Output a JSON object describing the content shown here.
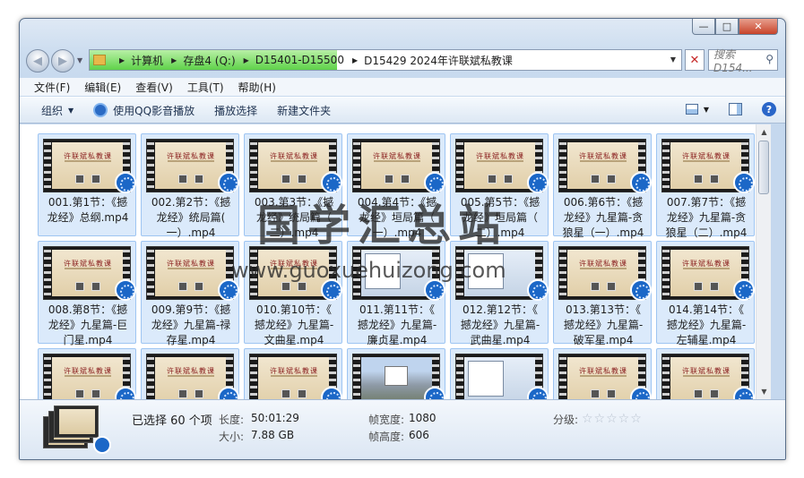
{
  "caption": {
    "min": "—",
    "max": "□",
    "close": "✕"
  },
  "address": {
    "crumbs": [
      "计算机",
      "存盘4 (Q:)",
      "D15401-D15500",
      "D15429 2024年许联斌私教课"
    ]
  },
  "search": {
    "placeholder": "搜索 D154..."
  },
  "menu": [
    "文件(F)",
    "编辑(E)",
    "查看(V)",
    "工具(T)",
    "帮助(H)"
  ],
  "commands": {
    "organize": "组织",
    "play_qq": "使用QQ影音播放",
    "play_selection": "播放选择",
    "new_folder": "新建文件夹"
  },
  "thumb_title": "许联斌私教课",
  "files": [
    {
      "name": "001.第1节：《撼龙经》总纲.mp4",
      "line1": "001.第1节：《撼",
      "line2": "龙经》总纲.mp4",
      "line3": "",
      "style": "title"
    },
    {
      "name": "002.第2节：《撼龙经》统局篇(一).mp4",
      "line1": "002.第2节：《撼",
      "line2": "龙经》统局篇(",
      "line3": "一）.mp4",
      "style": "title"
    },
    {
      "name": "003.第3节：《撼龙经》统局篇（二）.mp4",
      "line1": "003.第3节：《撼",
      "line2": "龙经》统局篇（",
      "line3": "二）.mp4",
      "style": "title"
    },
    {
      "name": "004.第4节：《撼龙经》垣局篇（一）.mp4",
      "line1": "004.第4节：《撼",
      "line2": "龙经》垣局篇（",
      "line3": "一）.mp4",
      "style": "title"
    },
    {
      "name": "005.第5节：《撼龙经》垣局篇（二）.mp4",
      "line1": "005.第5节：《撼",
      "line2": "龙经》垣局篇（",
      "line3": "二）.mp4",
      "style": "title"
    },
    {
      "name": "006.第6节：《撼龙经》九星篇-贪狼星（一）.mp4",
      "line1": "006.第6节：《撼",
      "line2": "龙经》九星篇-贪",
      "line3": "狼星（一）.mp4",
      "style": "title"
    },
    {
      "name": "007.第7节：《撼龙经》九星篇-贪狼星（二）.mp4",
      "line1": "007.第7节：《撼",
      "line2": "龙经》九星篇-贪",
      "line3": "狼星（二）.mp4",
      "style": "title"
    },
    {
      "name": "008.第8节：《撼龙经》九星篇-巨门星.mp4",
      "line1": "008.第8节：《撼",
      "line2": "龙经》九星篇-巨",
      "line3": "门星.mp4",
      "style": "title"
    },
    {
      "name": "009.第9节：《撼龙经》九星篇-禄存星.mp4",
      "line1": "009.第9节：《撼",
      "line2": "龙经》九星篇-禄",
      "line3": "存星.mp4",
      "style": "title"
    },
    {
      "name": "010.第10节：《撼龙经》九星篇-文曲星.mp4",
      "line1": "010.第10节：《",
      "line2": "撼龙经》九星篇-",
      "line3": "文曲星.mp4",
      "style": "title"
    },
    {
      "name": "011.第11节：《撼龙经》九星篇-廉贞星.mp4",
      "line1": "011.第11节：《",
      "line2": "撼龙经》九星篇-",
      "line3": "廉贞星.mp4",
      "style": "shot"
    },
    {
      "name": "012.第12节：《撼龙经》九星篇-武曲星.mp4",
      "line1": "012.第12节：《",
      "line2": "撼龙经》九星篇-",
      "line3": "武曲星.mp4",
      "style": "shot"
    },
    {
      "name": "013.第13节：《撼龙经》九星篇-破军星.mp4",
      "line1": "013.第13节：《",
      "line2": "撼龙经》九星篇-",
      "line3": "破军星.mp4",
      "style": "title"
    },
    {
      "name": "014.第14节：《撼龙经》九星篇-左辅星.mp4",
      "line1": "014.第14节：《",
      "line2": "撼龙经》九星篇-",
      "line3": "左辅星.mp4",
      "style": "title"
    },
    {
      "name": "",
      "line1": "",
      "line2": "",
      "line3": "",
      "style": "title"
    },
    {
      "name": "",
      "line1": "",
      "line2": "",
      "line3": "",
      "style": "title"
    },
    {
      "name": "",
      "line1": "",
      "line2": "",
      "line3": "",
      "style": "title"
    },
    {
      "name": "",
      "line1": "",
      "line2": "",
      "line3": "",
      "style": "landscape"
    },
    {
      "name": "",
      "line1": "",
      "line2": "",
      "line3": "",
      "style": "shot"
    },
    {
      "name": "",
      "line1": "",
      "line2": "",
      "line3": "",
      "style": "title"
    },
    {
      "name": "",
      "line1": "",
      "line2": "",
      "line3": "",
      "style": "title"
    }
  ],
  "details": {
    "selected": "已选择 60 个项",
    "length_key": "长度:",
    "length_val": "50:01:29",
    "size_key": "大小:",
    "size_val": "7.88 GB",
    "width_key": "帧宽度:",
    "width_val": "1080",
    "height_key": "帧高度:",
    "height_val": "606",
    "rating_key": "分级:",
    "stars": "☆☆☆☆☆"
  },
  "watermark": {
    "cn": "国学汇总站",
    "url": "www.guoxuehuizong.com"
  }
}
